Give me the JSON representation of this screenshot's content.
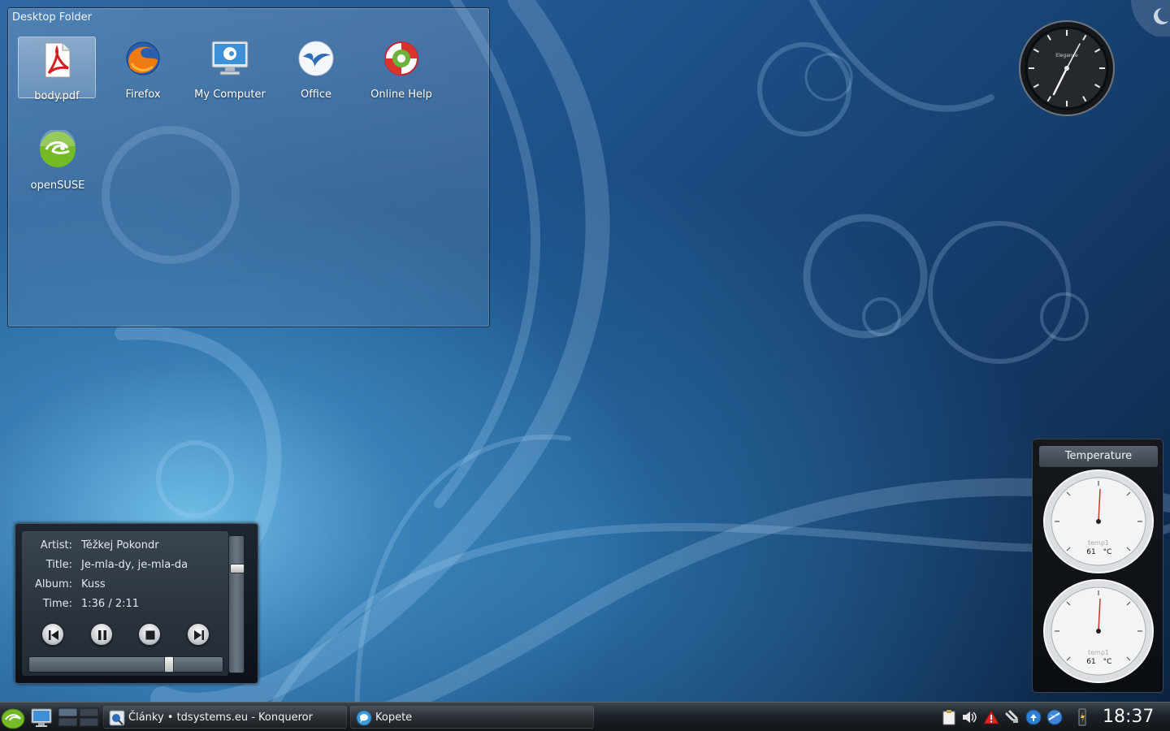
{
  "desktop": {
    "folder": {
      "title": "Desktop Folder",
      "icons": [
        {
          "label": "body.pdf",
          "icon": "pdf-document-icon",
          "selected": true
        },
        {
          "label": "Firefox",
          "icon": "firefox-icon"
        },
        {
          "label": "My Computer",
          "icon": "computer-monitor-icon"
        },
        {
          "label": "Office",
          "icon": "office-icon"
        },
        {
          "label": "Online Help",
          "icon": "lifebuoy-help-icon"
        },
        {
          "label": "openSUSE",
          "icon": "opensuse-logo-icon"
        }
      ]
    },
    "clock_widget": {
      "brand": "Elegance",
      "time": "18:37"
    },
    "media_player": {
      "artist_label": "Artist:",
      "artist": "Těžkej Pokondr",
      "title_label": "Title:",
      "title": "Je-mla-dy, je-mla-da",
      "album_label": "Album:",
      "album": "Kuss",
      "time_label": "Time:",
      "time": "1:36 / 2:11",
      "progress": 0.735,
      "volume": 0.78,
      "controls": [
        "previous-icon",
        "pause-icon",
        "stop-icon",
        "next-icon"
      ]
    },
    "temperature": {
      "title": "Temperature",
      "gauges": [
        {
          "sensor": "temp1",
          "value": "61",
          "unit": "°C"
        },
        {
          "sensor": "temp1",
          "value": "61",
          "unit": "°C"
        }
      ]
    }
  },
  "taskbar": {
    "tasks": [
      {
        "label": "Články • tdsystems.eu - Konqueror",
        "icon": "konqueror-icon"
      },
      {
        "label": "Kopete",
        "icon": "kopete-icon"
      }
    ],
    "tray_icons": [
      "clipboard-icon",
      "volume-icon",
      "warning-icon",
      "network-icon",
      "update-icon",
      "globe-icon",
      "battery-icon"
    ],
    "clock": "18:37"
  },
  "colors": {
    "accent": "#2f6aa6",
    "panel": "#1e2329",
    "opensuse_green": "#73ba25"
  }
}
